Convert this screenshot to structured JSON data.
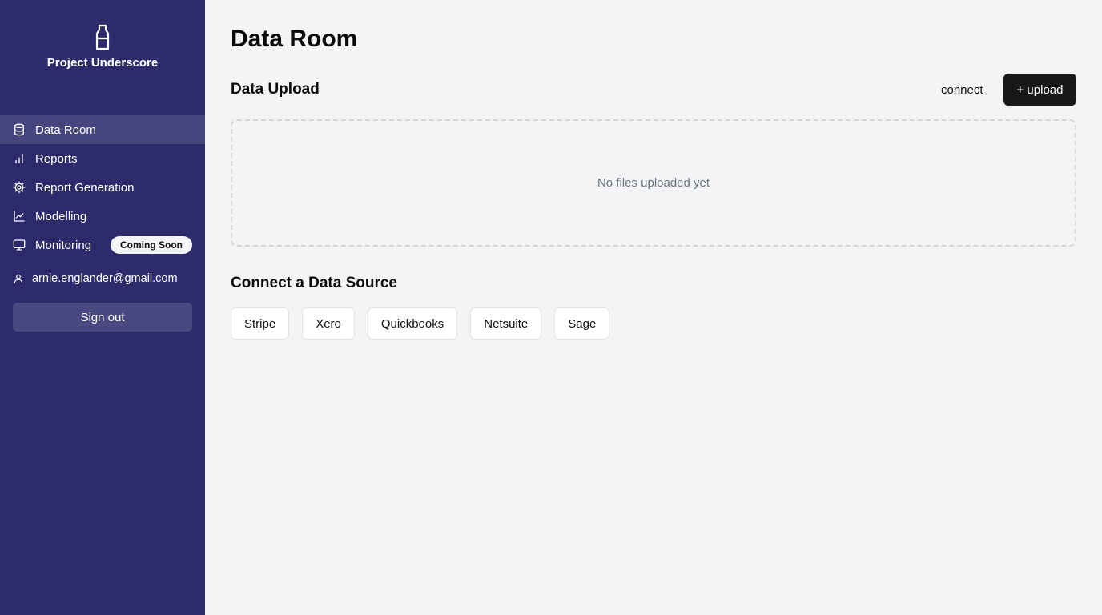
{
  "sidebar": {
    "brand": {
      "name": "Project Underscore",
      "icon": "bottle-icon"
    },
    "items": [
      {
        "label": "Data Room",
        "icon": "database-icon",
        "active": true
      },
      {
        "label": "Reports",
        "icon": "bar-chart-icon"
      },
      {
        "label": "Report Generation",
        "icon": "gear-icon"
      },
      {
        "label": "Modelling",
        "icon": "line-chart-icon"
      },
      {
        "label": "Monitoring",
        "icon": "monitor-icon",
        "badge": "Coming Soon"
      }
    ],
    "user": {
      "email": "arnie.englander@gmail.com",
      "icon": "user-icon"
    },
    "sign_out_label": "Sign out"
  },
  "main": {
    "title": "Data Room",
    "upload": {
      "title": "Data Upload",
      "connect_label": "connect",
      "upload_label": "+ upload",
      "empty_text": "No files uploaded yet"
    },
    "connect": {
      "title": "Connect a Data Source",
      "sources": [
        "Stripe",
        "Xero",
        "Quickbooks",
        "Netsuite",
        "Sage"
      ]
    }
  },
  "colors": {
    "sidebar_bg": "#2d2b6b",
    "main_bg": "#f3f4f6",
    "primary_button": "#18181b",
    "sign_out_bg": "#494880"
  }
}
